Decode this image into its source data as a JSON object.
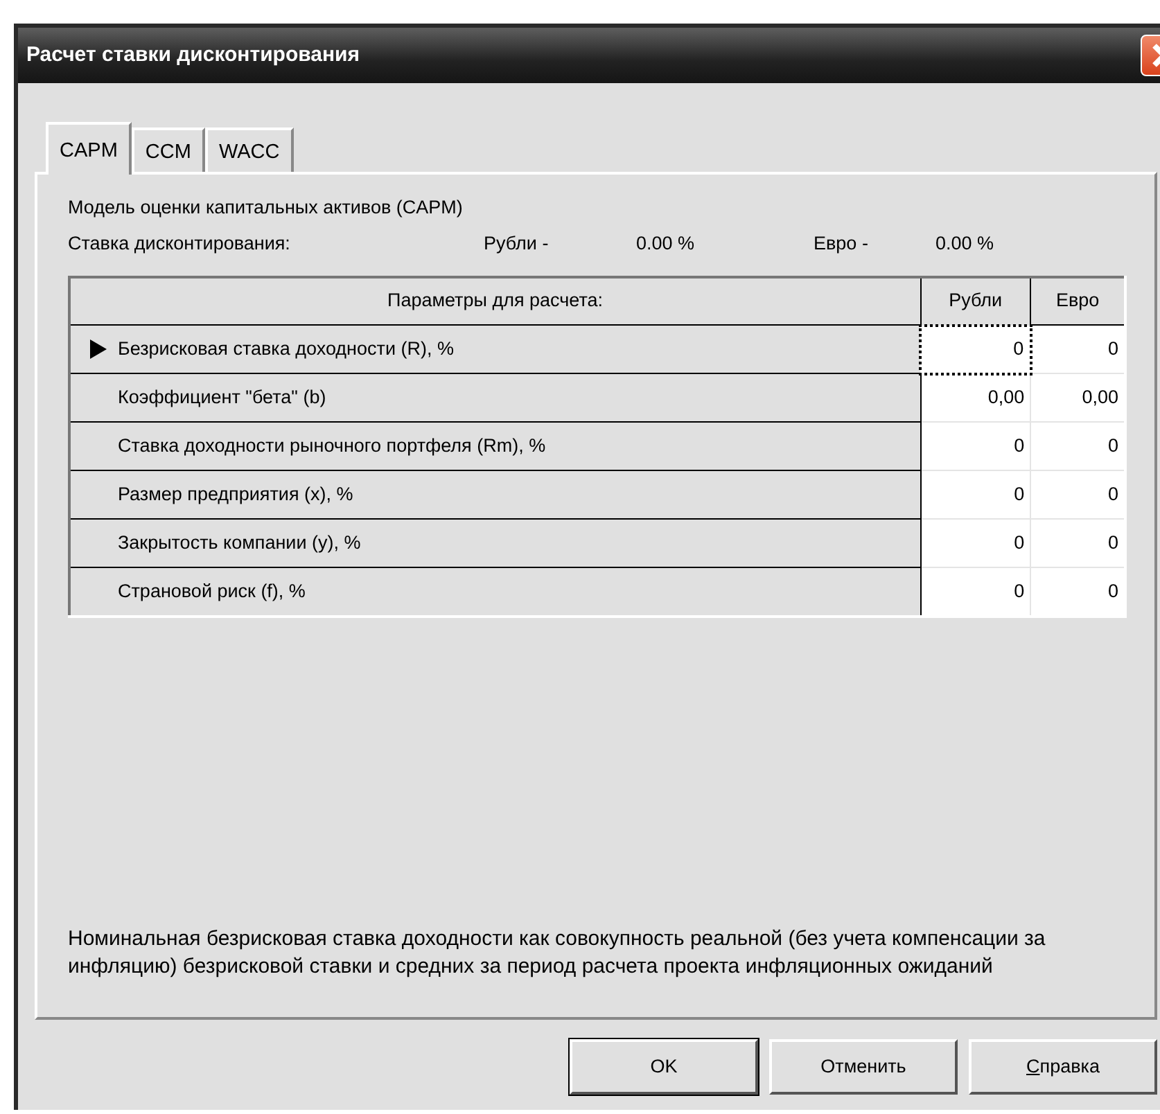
{
  "window": {
    "title": "Расчет ставки дисконтирования"
  },
  "tabs": [
    {
      "label": "CAPM",
      "selected": true
    },
    {
      "label": "CCM",
      "selected": false
    },
    {
      "label": "WACC",
      "selected": false
    }
  ],
  "model_title": "Модель оценки капитальных активов (CAPM)",
  "rate": {
    "label": "Ставка дисконтирования:",
    "rub_label": "Рубли -",
    "rub_value": "0.00 %",
    "eur_label": "Евро -",
    "eur_value": "0.00 %"
  },
  "table": {
    "columns": [
      "Параметры для расчета:",
      "Рубли",
      "Евро"
    ],
    "rows": [
      {
        "name": "Безрисковая ставка доходности (R), %",
        "current": true,
        "rub": "0",
        "eur": "0",
        "focused": true
      },
      {
        "name": "Коэффициент \"бета\" (b)",
        "current": false,
        "rub": "0,00",
        "eur": "0,00",
        "focused": false
      },
      {
        "name": "Ставка доходности рыночного портфеля (Rm), %",
        "current": false,
        "rub": "0",
        "eur": "0",
        "focused": false
      },
      {
        "name": "Размер предприятия (x), %",
        "current": false,
        "rub": "0",
        "eur": "0",
        "focused": false
      },
      {
        "name": "Закрытость компании (y), %",
        "current": false,
        "rub": "0",
        "eur": "0",
        "focused": false
      },
      {
        "name": "Страновой риск (f), %",
        "current": false,
        "rub": "0",
        "eur": "0",
        "focused": false
      }
    ]
  },
  "description": "Номинальная безрисковая ставка доходности как совокупность реальной (без учета компенсации за инфляцию) безрисковой ставки и средних за период расчета проекта инфляционных ожиданий",
  "buttons": [
    {
      "label": "OK",
      "default": true,
      "first_letter_underlined": false
    },
    {
      "label": "Отменить",
      "default": false,
      "first_letter_underlined": false
    },
    {
      "label": "Справка",
      "default": false,
      "first_letter_underlined": true
    }
  ]
}
